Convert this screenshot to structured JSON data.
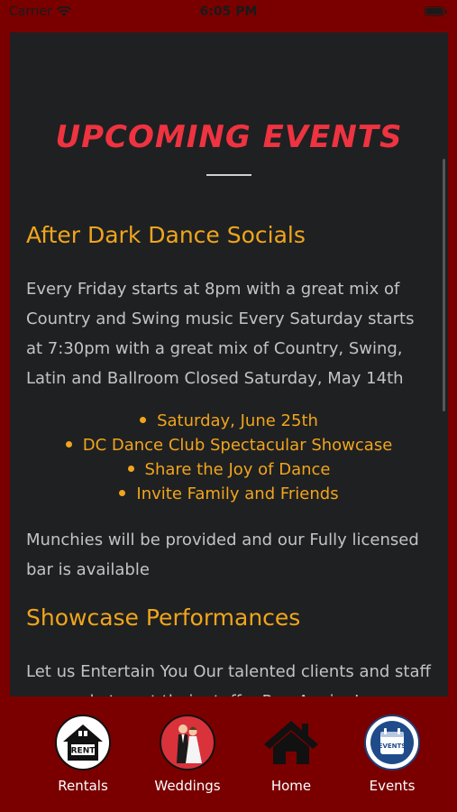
{
  "status_bar": {
    "carrier": "Carrier",
    "time": "6:05 PM"
  },
  "page": {
    "title": "UPCOMING EVENTS",
    "sections": [
      {
        "heading": "After Dark Dance Socials",
        "body": "Every Friday starts at 8pm with a great mix of Country and Swing music Every Saturday starts at 7:30pm with a great mix of Country, Swing, Latin and Ballroom Closed Saturday, May 14th",
        "bullets": [
          "Saturday, June 25th",
          "DC Dance Club Spectacular Showcase",
          "Share the Joy of Dance",
          "Invite Family and Friends"
        ],
        "footer": "Munchies will be provided and our Fully licensed bar is available"
      },
      {
        "heading": "Showcase Performances",
        "body": "Let us Entertain You Our talented clients and staff are ready to get their stuff... Ron Angie, Lu"
      }
    ]
  },
  "tab_bar": {
    "tabs": [
      {
        "label": "Rentals",
        "icon": "house-rent-icon"
      },
      {
        "label": "Weddings",
        "icon": "wedding-couple-icon"
      },
      {
        "label": "Home",
        "icon": "home-icon"
      },
      {
        "label": "Events",
        "icon": "events-calendar-icon"
      }
    ]
  },
  "colors": {
    "frame": "#7a0000",
    "panel": "#1f2022",
    "title": "#ef3340",
    "accent": "#f0a51c",
    "body_text": "#c2c3c4"
  }
}
